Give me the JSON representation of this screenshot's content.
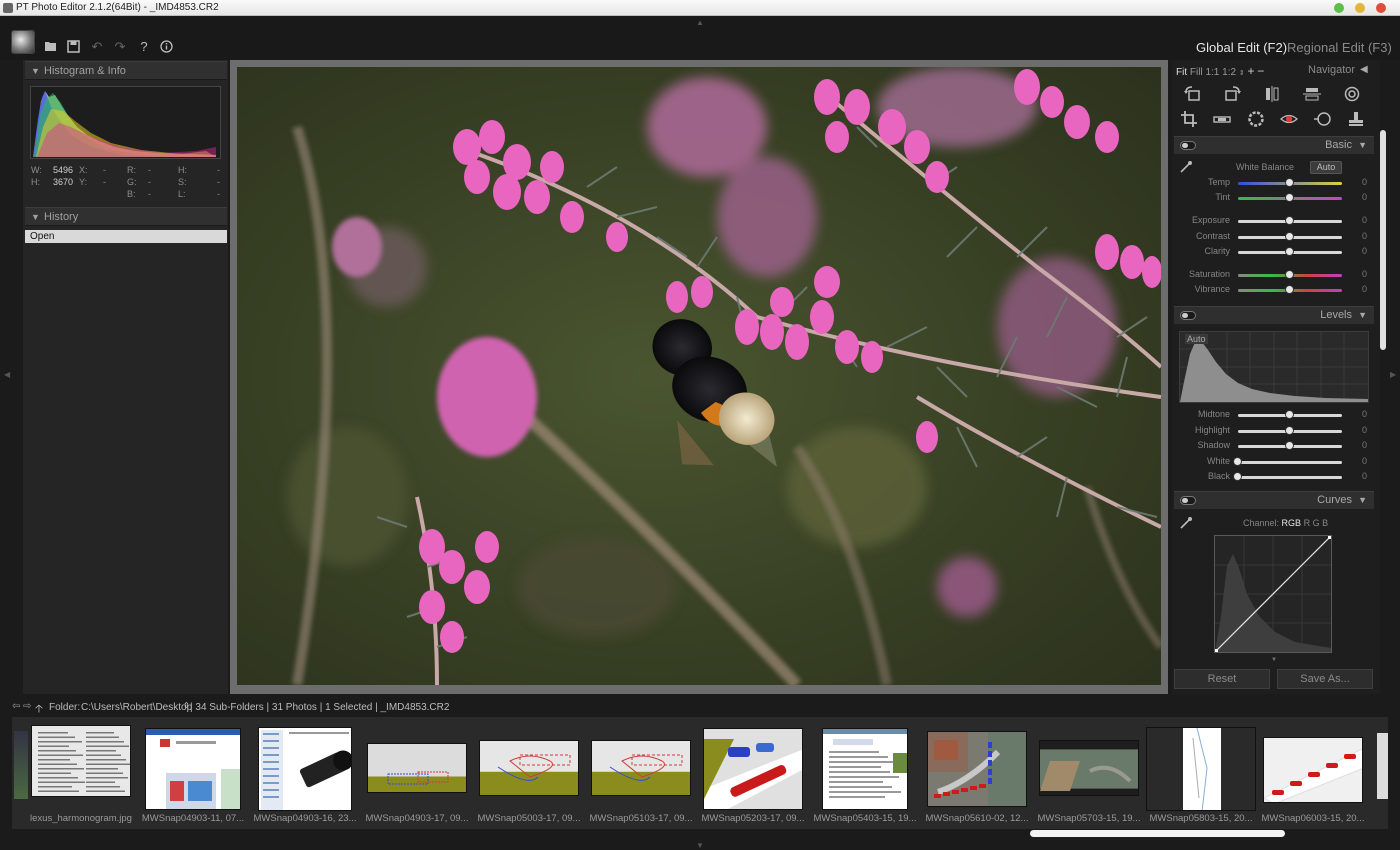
{
  "window": {
    "title": "PT Photo Editor 2.1.2(64Bit) - _IMD4853.CR2",
    "buttons": [
      "minimize-button",
      "maximize-button",
      "close-button"
    ],
    "colors": {
      "minimize": "#5cbf4a",
      "maximize": "#e5b53a",
      "close": "#e04c3c"
    }
  },
  "toolbar": {
    "icons": [
      "logo-icon",
      "open-folder-icon",
      "save-icon",
      "undo-icon",
      "redo-icon",
      "help-icon",
      "info-icon"
    ],
    "help_glyph": "?"
  },
  "mode_tabs": {
    "global": "Global Edit (F2)",
    "regional": "Regional Edit (F3)"
  },
  "left": {
    "histogram_title": "Histogram & Info",
    "history_title": "History",
    "info": {
      "w_label": "W:",
      "w_value": "5496",
      "h_label": "H:",
      "h_value": "3670",
      "x_label": "X:",
      "x_value": "-",
      "y_label": "Y:",
      "y_value": "-",
      "r_label": "R:",
      "r_value": "-",
      "g_label": "G:",
      "g_value": "-",
      "b_label": "B:",
      "b_value": "-",
      "hh_label": "H:",
      "hh_value": "-",
      "s_label": "S:",
      "s_value": "-",
      "l_label": "L:",
      "l_value": "-"
    },
    "history_items": [
      "Open"
    ]
  },
  "navigator": {
    "zoom_fit": "Fit",
    "zoom_fill": "Fill",
    "zoom_1_1": "1:1",
    "zoom_1_2": "1:2",
    "zoom_in": "+",
    "zoom_out": "−",
    "title": "Navigator"
  },
  "tools": {
    "row1": [
      "rotate-left-icon",
      "rotate-right-icon",
      "flip-horizontal-icon",
      "flip-vertical-icon",
      "spiral-icon"
    ],
    "row2": [
      "crop-icon",
      "straighten-icon",
      "vignette-icon",
      "red-eye-icon",
      "radial-filter-icon",
      "clone-stamp-icon"
    ]
  },
  "basic": {
    "title": "Basic",
    "white_balance_label": "White Balance",
    "auto_label": "Auto",
    "sliders": [
      {
        "label": "Temp",
        "value": "0",
        "level": 0.5
      },
      {
        "label": "Tint",
        "value": "0",
        "level": 0.5
      },
      {
        "label": "Exposure",
        "value": "0",
        "level": 0.5
      },
      {
        "label": "Contrast",
        "value": "0",
        "level": 0.5
      },
      {
        "label": "Clarity",
        "value": "0",
        "level": 0.5
      },
      {
        "label": "Saturation",
        "value": "0",
        "level": 0.5
      },
      {
        "label": "Vibrance",
        "value": "0",
        "level": 0.5
      }
    ]
  },
  "levels": {
    "title": "Levels",
    "auto_label": "Auto",
    "sliders": [
      {
        "label": "Midtone",
        "value": "0",
        "level": 0.5
      },
      {
        "label": "Highlight",
        "value": "0",
        "level": 0.5
      },
      {
        "label": "Shadow",
        "value": "0",
        "level": 0.5
      },
      {
        "label": "White",
        "value": "0",
        "level": 0.0
      },
      {
        "label": "Black",
        "value": "0",
        "level": 0.0
      }
    ]
  },
  "curves": {
    "title": "Curves",
    "channel_label": "Channel:",
    "channels": [
      "RGB",
      "R",
      "G",
      "B"
    ]
  },
  "actions": {
    "reset": "Reset",
    "save_as": "Save As..."
  },
  "folder_bar": {
    "label": "Folder:",
    "path": "C:\\Users\\Robert\\Desktop",
    "stats": "| 34 Sub-Folders | 31 Photos | 1 Selected | _IMD4853.CR2"
  },
  "filmstrip": [
    {
      "caption": "lexus_harmonogram.jpg",
      "kind": "doc"
    },
    {
      "caption": "MWSnap04903-11, 07...",
      "kind": "web"
    },
    {
      "caption": "MWSnap04903-16, 23...",
      "kind": "camera"
    },
    {
      "caption": "MWSnap04903-17, 09...",
      "kind": "cad-grey"
    },
    {
      "caption": "MWSnap05003-17, 09...",
      "kind": "cad-olive"
    },
    {
      "caption": "MWSnap05103-17, 09...",
      "kind": "cad-olive"
    },
    {
      "caption": "MWSnap05203-17, 09...",
      "kind": "cad-cars"
    },
    {
      "caption": "MWSnap05403-15, 19...",
      "kind": "web2"
    },
    {
      "caption": "MWSnap05610-02, 12...",
      "kind": "aerial-cars"
    },
    {
      "caption": "MWSnap05703-15, 19...",
      "kind": "aerial"
    },
    {
      "caption": "MWSnap05803-15, 20...",
      "kind": "plan"
    },
    {
      "caption": "MWSnap06003-15, 20...",
      "kind": "cad-road"
    }
  ]
}
